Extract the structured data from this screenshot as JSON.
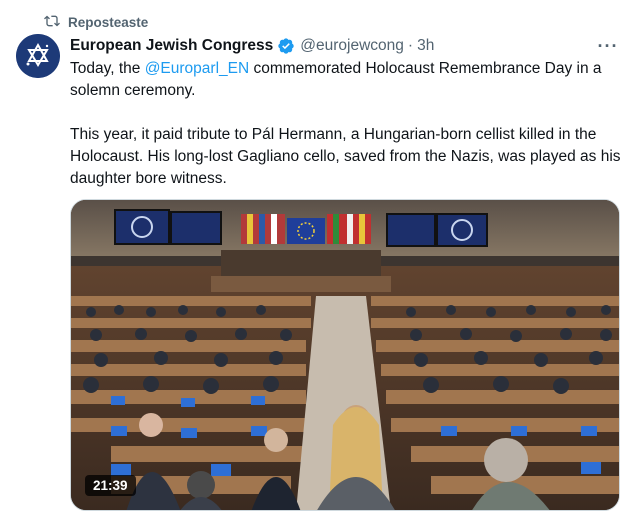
{
  "repost": {
    "label": "Reposteaste",
    "icon": "repost-icon"
  },
  "author": {
    "name": "European Jewish Congress",
    "handle": "@eurojewcong",
    "separator": "·",
    "time": "3h",
    "verified": true,
    "avatar_icon": "star-of-david-icon"
  },
  "more_label": "···",
  "body": {
    "p1_before": "Today, the ",
    "p1_mention": "@Europarl_EN",
    "p1_after": " commemorated Holocaust Remembrance Day in a solemn ceremony.",
    "p2": "This year, it paid tribute to Pál Hermann, a Hungarian-born cellist killed in the Holocaust. His long-lost Gagliano cello, saved from the Nazis, was played as his daughter bore witness."
  },
  "media": {
    "duration": "21:39",
    "type": "video"
  },
  "colors": {
    "link": "#1d9bf0",
    "verified": "#1d9bf0",
    "secondary": "#536471",
    "avatar_bg": "#1d3a78"
  }
}
